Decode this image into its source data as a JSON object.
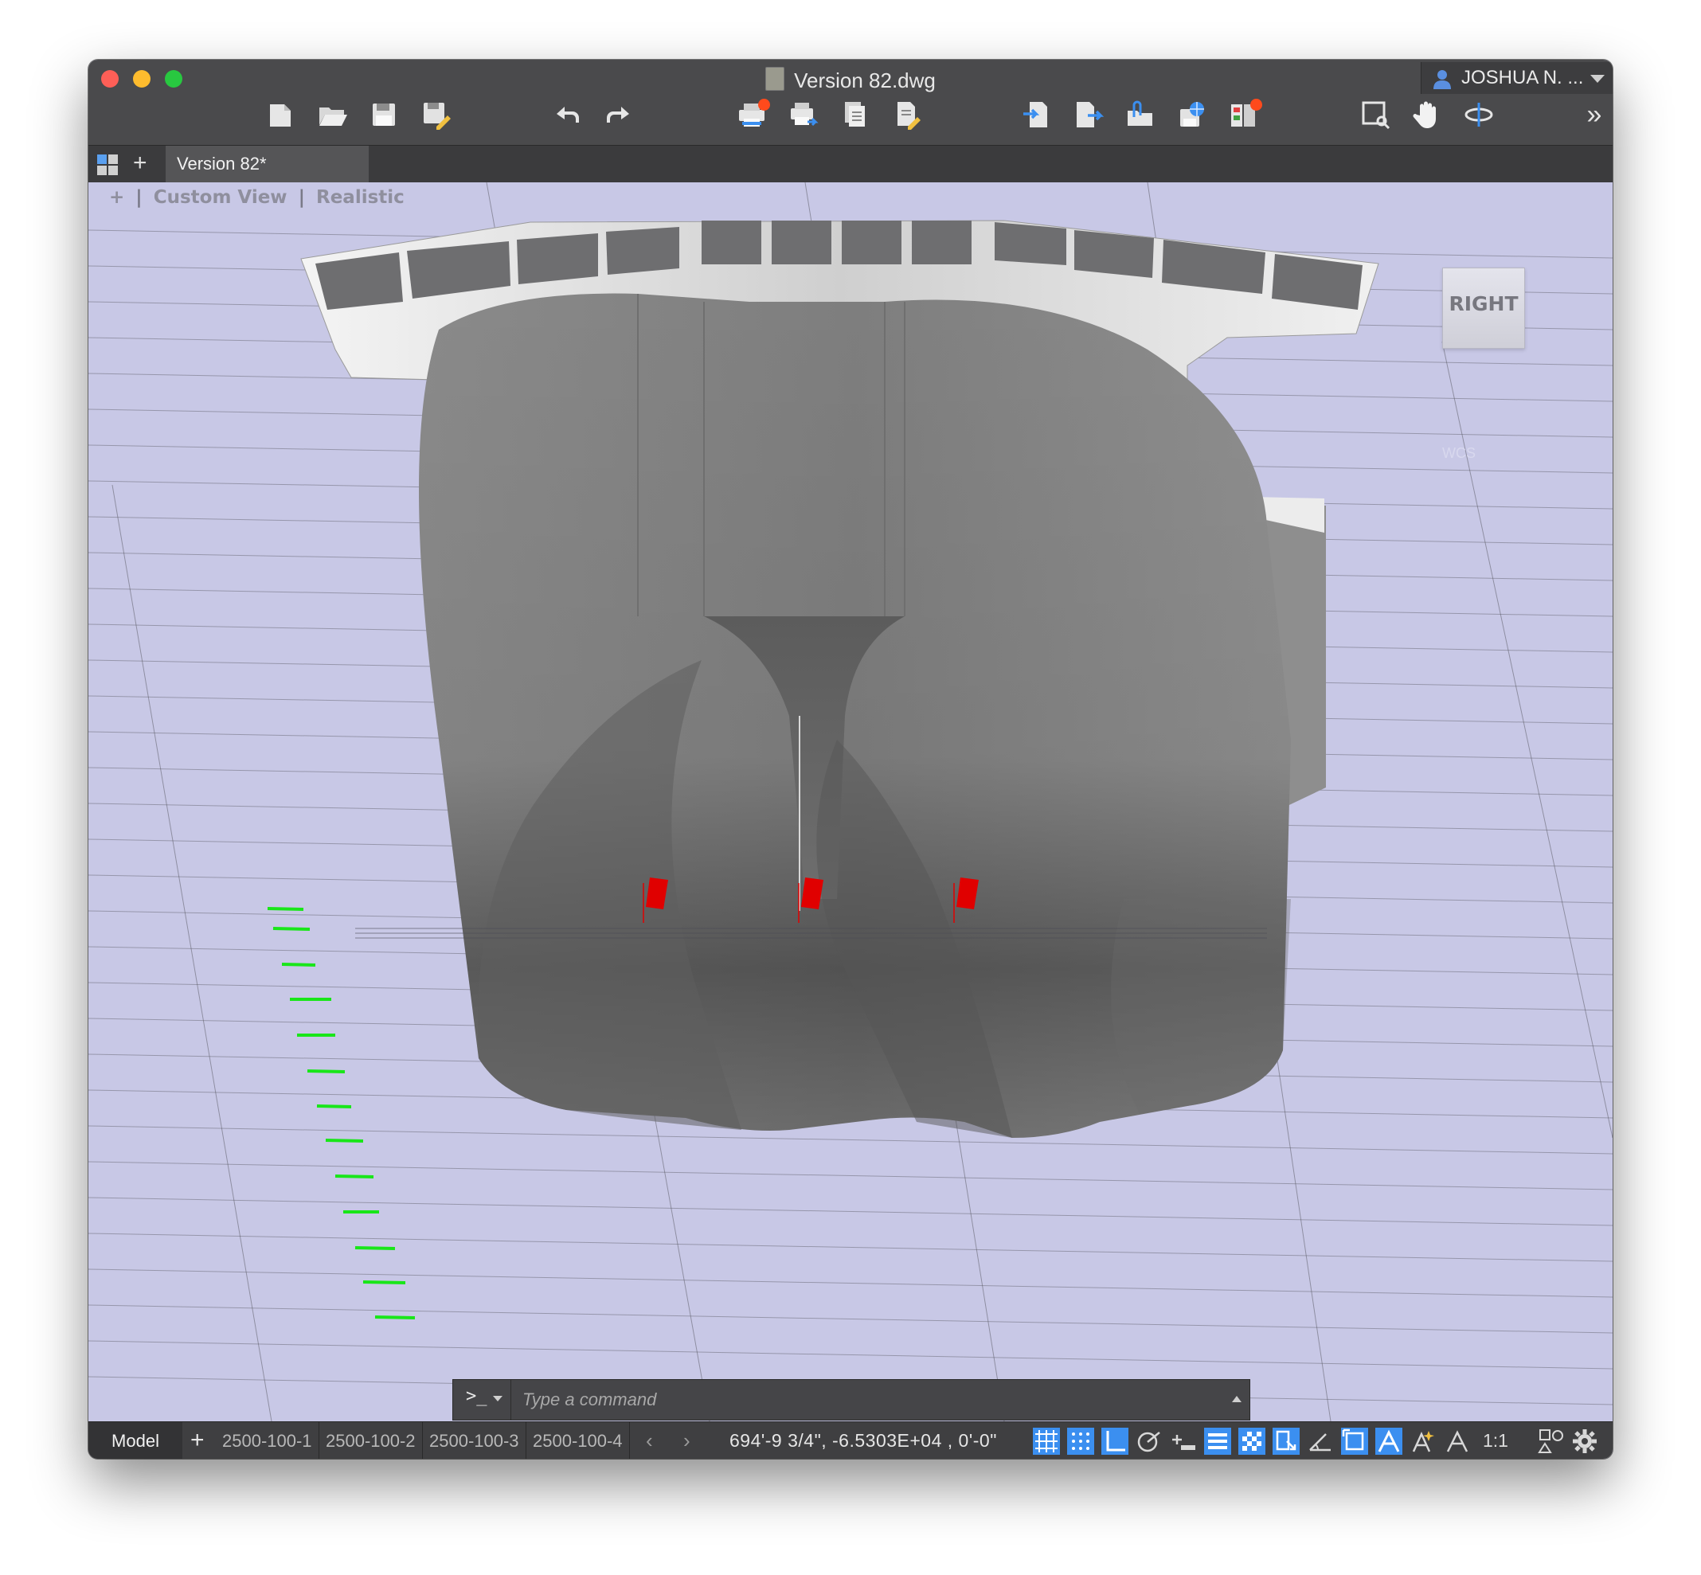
{
  "window": {
    "title": "Version 82.dwg",
    "user": "JOSHUA N. ..."
  },
  "toolbar": {
    "icons": [
      "new-icon",
      "open-icon",
      "save-icon",
      "save-as-icon",
      "undo-icon",
      "redo-icon",
      "plot-icon",
      "batch-plot-icon",
      "publish-icon",
      "page-setup-icon",
      "import-icon",
      "export-icon",
      "attach-icon",
      "etransmit-icon",
      "sheet-set-icon",
      "zoom-window-icon",
      "pan-icon",
      "orbit-icon",
      "more-icon"
    ],
    "more_glyph": "»"
  },
  "tabs": {
    "document": "Version 82*"
  },
  "viewport": {
    "controls": "+",
    "view_name": "Custom View",
    "visual_style": "Realistic",
    "viewcube_face": "RIGHT",
    "ucs_label": "WCS"
  },
  "command_line": {
    "prompt": ">_",
    "placeholder": "Type a command"
  },
  "status_bar": {
    "model_tab": "Model",
    "layouts": [
      "2500-100-1",
      "2500-100-2",
      "2500-100-3",
      "2500-100-4"
    ],
    "coordinates": "694'-9 3/4\",  -6.5303E+04 , 0'-0\"",
    "annotation_scale": "1:1",
    "icons": [
      "grid-icon",
      "snap-icon",
      "ortho-icon",
      "polar-icon",
      "osnap-tracking-icon",
      "lineweight-icon",
      "transparency-icon",
      "selection-cycling-icon",
      "dynamic-ucs-icon",
      "ucs-icon",
      "annotation-visibility-icon",
      "auto-scale-icon",
      "annotation-scale-icon",
      "workspace-icon",
      "settings-icon"
    ]
  },
  "colors": {
    "viewport_background": "#c8c8e6",
    "hull": "#8a8a8a",
    "accent_red_markers": "#e00000",
    "accent_green_markers": "#19e619",
    "toolbar_blue_active": "#3b8ff0"
  }
}
